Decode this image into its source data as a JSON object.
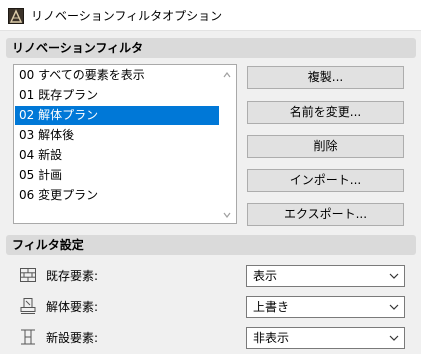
{
  "window": {
    "title": "リノベーションフィルタオプション"
  },
  "filter_section": {
    "header": "リノベーションフィルタ",
    "items": [
      {
        "label": "00 すべての要素を表示",
        "selected": false
      },
      {
        "label": "01 既存プラン",
        "selected": false
      },
      {
        "label": "02 解体プラン",
        "selected": true
      },
      {
        "label": "03 解体後",
        "selected": false
      },
      {
        "label": "04 新設",
        "selected": false
      },
      {
        "label": "05 計画",
        "selected": false
      },
      {
        "label": "06 変更プラン",
        "selected": false
      }
    ],
    "buttons": {
      "duplicate": "複製...",
      "rename": "名前を変更...",
      "delete": "削除",
      "import": "インポート...",
      "export": "エクスポート..."
    }
  },
  "settings_section": {
    "header": "フィルタ設定",
    "rows": [
      {
        "label": "既存要素:",
        "value": "表示",
        "icon": "existing-elements-icon"
      },
      {
        "label": "解体要素:",
        "value": "上書き",
        "icon": "demolished-elements-icon"
      },
      {
        "label": "新設要素:",
        "value": "非表示",
        "icon": "new-elements-icon"
      }
    ]
  },
  "colors": {
    "selection": "#0078d7",
    "section_header": "#dadada",
    "background": "#f0f0f0"
  }
}
